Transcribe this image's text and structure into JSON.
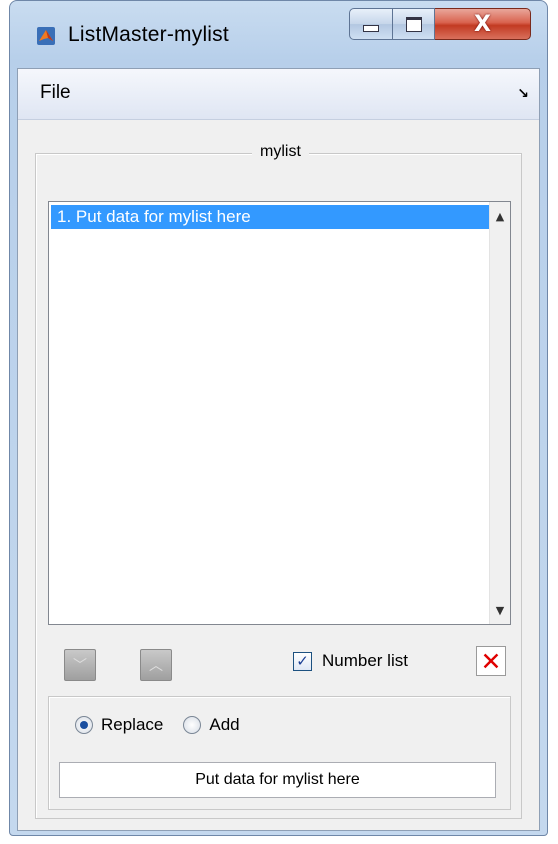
{
  "window": {
    "title": "ListMaster-mylist",
    "controls": {
      "minimize_icon": "minimize-icon",
      "maximize_icon": "maximize-icon",
      "close_icon": "close-icon",
      "close_glyph": "X"
    }
  },
  "menubar": {
    "file_label": "File",
    "corner_glyph": "↘"
  },
  "panel": {
    "title": "mylist",
    "list_items": [
      "1. Put data for mylist here"
    ],
    "selected_index": 0,
    "scroll_up_glyph": "▲",
    "scroll_down_glyph": "▼"
  },
  "controls": {
    "move_down_glyph": "﹀",
    "move_up_glyph": "︿",
    "number_list_label": "Number list",
    "number_list_checked": true,
    "check_glyph": "✓",
    "delete_glyph": "✕"
  },
  "input_area": {
    "replace_label": "Replace",
    "add_label": "Add",
    "mode_selected": "Replace",
    "input_value": "Put data for mylist here"
  },
  "colors": {
    "selection": "#3399ff",
    "delete_red": "#e00000",
    "close_button": "#c23a22"
  }
}
